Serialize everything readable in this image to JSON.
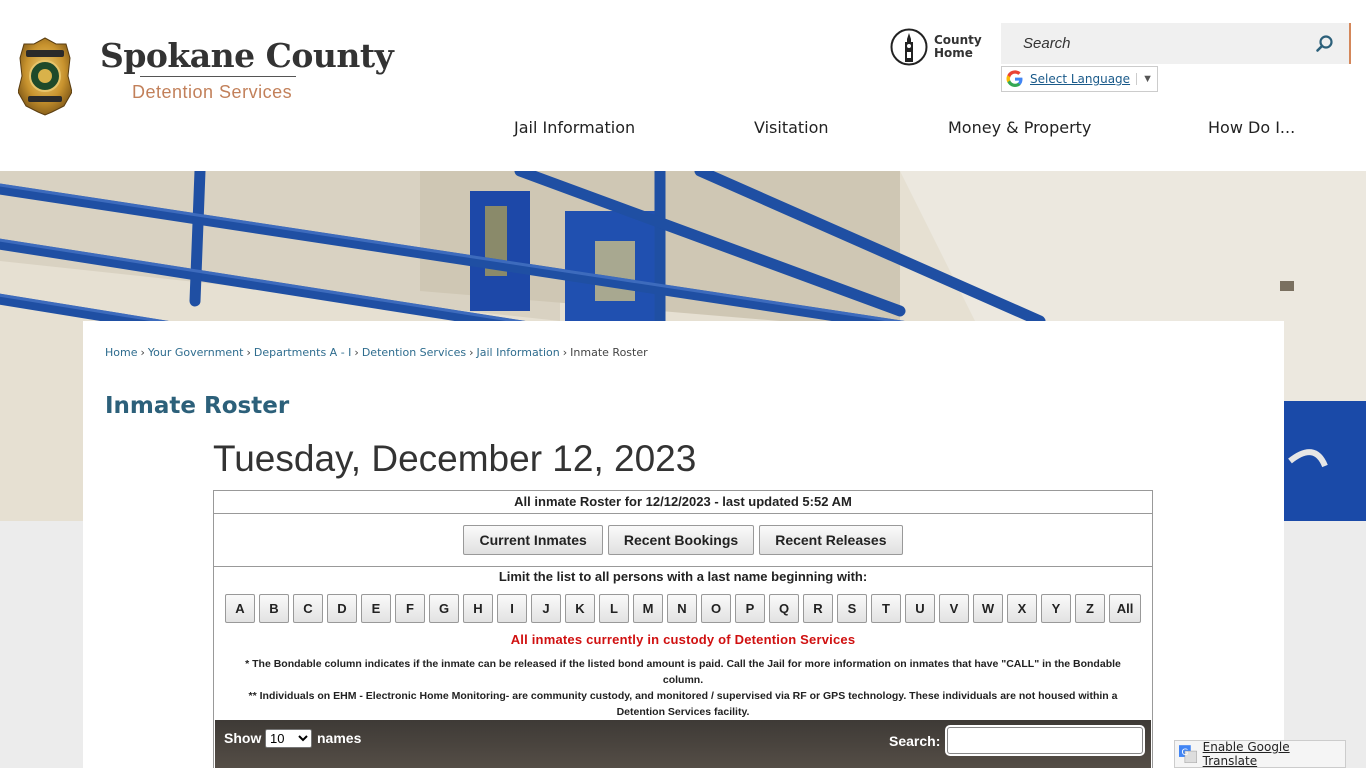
{
  "header": {
    "site_title": "Spokane County",
    "site_subtitle": "Detention Services",
    "county_home": "County Home",
    "search_placeholder": "Search",
    "translate_label": "Select Language",
    "translate_arrow": "▼"
  },
  "nav": {
    "items": [
      {
        "label": "Jail Information"
      },
      {
        "label": "Visitation"
      },
      {
        "label": "Money & Property"
      },
      {
        "label": "How Do I..."
      }
    ]
  },
  "breadcrumb": {
    "items": [
      "Home",
      "Your Government",
      "Departments A - I",
      "Detention Services",
      "Jail Information"
    ],
    "current": "Inmate Roster",
    "separator": "›"
  },
  "page": {
    "title": "Inmate Roster",
    "date_heading": "Tuesday, December 12, 2023"
  },
  "roster": {
    "caption": "All inmate Roster for 12/12/2023 - last updated 5:52 AM",
    "buttons": [
      "Current Inmates",
      "Recent Bookings",
      "Recent Releases"
    ],
    "limit_text": "Limit the list to all persons with a last name beginning with:",
    "letters": [
      "A",
      "B",
      "C",
      "D",
      "E",
      "F",
      "G",
      "H",
      "I",
      "J",
      "K",
      "L",
      "M",
      "N",
      "O",
      "P",
      "Q",
      "R",
      "S",
      "T",
      "U",
      "V",
      "W",
      "X",
      "Y",
      "Z",
      "All"
    ],
    "custody_text": "All inmates currently in custody of Detention Services",
    "note1": "* The Bondable column indicates if the inmate can be released if the listed bond amount is paid. Call the Jail for more information on inmates that have \"CALL\" in the Bondable column.",
    "note2": "** Individuals on EHM - Electronic Home Monitoring- are community custody, and monitored / supervised via RF or GPS technology. These individuals are not housed within a Detention Services facility.",
    "show_label": "Show",
    "show_value": "10",
    "names_label": "names",
    "search_label": "Search:"
  },
  "footer": {
    "enable_translate": "Enable Google Translate"
  },
  "colors": {
    "accent_orange": "#c2805a",
    "title_blue": "#2c607a",
    "link_blue": "#2e6c8e",
    "alert_red": "#d01010",
    "table_bar": "#4a443e",
    "railing_blue": "#1f4fa3"
  }
}
